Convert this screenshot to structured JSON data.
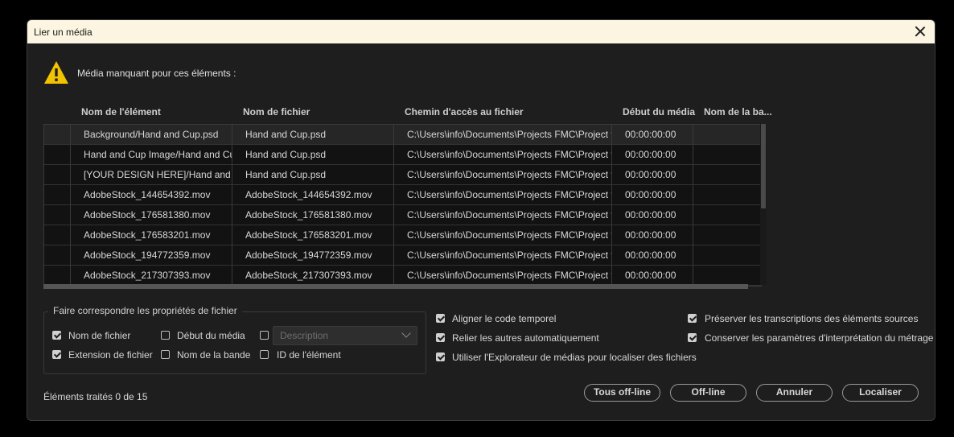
{
  "dialog": {
    "title": "Lier un média"
  },
  "warning": {
    "text": "Média manquant pour ces éléments :"
  },
  "table": {
    "headers": [
      "Nom de l'élément",
      "Nom de fichier",
      "Chemin d'accès au fichier",
      "Début du média",
      "Nom de la ba..."
    ],
    "rows": [
      [
        "Background/Hand and Cup.psd",
        "Hand and Cup.psd",
        "C:\\Users\\info\\Documents\\Projects FMC\\Project files\\",
        "00:00:00:00",
        ""
      ],
      [
        "Hand and Cup Image/Hand and Cup.psd",
        "Hand and Cup.psd",
        "C:\\Users\\info\\Documents\\Projects FMC\\Project files\\",
        "00:00:00:00",
        ""
      ],
      [
        "[YOUR DESIGN HERE]/Hand and Cup.psd",
        "Hand and Cup.psd",
        "C:\\Users\\info\\Documents\\Projects FMC\\Project files\\",
        "00:00:00:00",
        ""
      ],
      [
        "AdobeStock_144654392.mov",
        "AdobeStock_144654392.mov",
        "C:\\Users\\info\\Documents\\Projects FMC\\Project files\\",
        "00:00:00:00",
        ""
      ],
      [
        "AdobeStock_176581380.mov",
        "AdobeStock_176581380.mov",
        "C:\\Users\\info\\Documents\\Projects FMC\\Project files\\",
        "00:00:00:00",
        ""
      ],
      [
        "AdobeStock_176583201.mov",
        "AdobeStock_176583201.mov",
        "C:\\Users\\info\\Documents\\Projects FMC\\Project files\\",
        "00:00:00:00",
        ""
      ],
      [
        "AdobeStock_194772359.mov",
        "AdobeStock_194772359.mov",
        "C:\\Users\\info\\Documents\\Projects FMC\\Project files\\",
        "00:00:00:00",
        ""
      ],
      [
        "AdobeStock_217307393.mov",
        "AdobeStock_217307393.mov",
        "C:\\Users\\info\\Documents\\Projects FMC\\Project files\\",
        "00:00:00:00",
        ""
      ]
    ]
  },
  "match_group": {
    "title": "Faire correspondre les propriétés de fichier",
    "file_name": {
      "label": "Nom de fichier",
      "checked": true
    },
    "file_ext": {
      "label": "Extension de fichier",
      "checked": true
    },
    "media_start": {
      "label": "Début du média",
      "checked": false
    },
    "tape_name": {
      "label": "Nom de la bande",
      "checked": false
    },
    "description": {
      "checked": false,
      "placeholder": "Description"
    },
    "clip_id": {
      "label": "ID de l'élément",
      "checked": false
    }
  },
  "options": {
    "align_timecode": {
      "label": "Aligner le code temporel",
      "checked": true
    },
    "relink_others": {
      "label": "Relier les autres automatiquement",
      "checked": true
    },
    "use_browser": {
      "label": "Utiliser l'Explorateur de médias pour localiser des fichiers",
      "checked": true
    },
    "preserve_transcripts": {
      "label": "Préserver les transcriptions des éléments sources",
      "checked": true
    },
    "keep_interpretation": {
      "label": "Conserver les paramètres d'interprétation du métrage",
      "checked": true
    }
  },
  "status": "Éléments traités 0 de 15",
  "buttons": {
    "all_offline": "Tous off-line",
    "offline": "Off-line",
    "cancel": "Annuler",
    "locate": "Localiser"
  },
  "colors": {
    "warning_yellow": "#f2c300",
    "background": "#1e1e1e",
    "titlebar": "#fbf5e1"
  }
}
